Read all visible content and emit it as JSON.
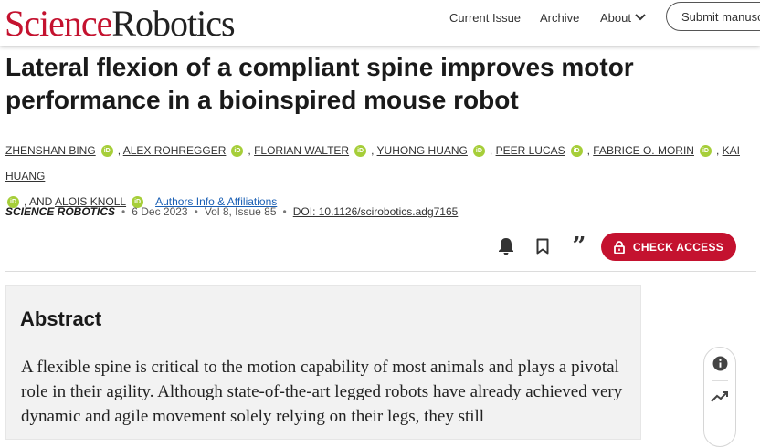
{
  "header": {
    "logo": {
      "science": "Science",
      "robotics": "Robotics"
    },
    "nav": {
      "current_issue": "Current Issue",
      "archive": "Archive",
      "about": "About"
    },
    "submit_label": "Submit manuscript"
  },
  "article": {
    "title": "Lateral flexion of a compliant spine improves motor performance in a bioinspired mouse robot",
    "authors": [
      "Zhenshan Bing",
      "Alex Rohregger",
      "Florian Walter",
      "Yuhong Huang",
      "Peer Lucas",
      "Fabrice O. Morin",
      "Kai Huang",
      "Alois Knoll"
    ],
    "orcid_label": "iD",
    "and_label": ", AND",
    "affiliations_link": "Authors Info & Affiliations",
    "journal": "SCIENCE ROBOTICS",
    "date": "6 Dec 2023",
    "volume": "Vol 8, Issue 85",
    "doi": "DOI: 10.1126/scirobotics.adg7165",
    "meta_separator": "•"
  },
  "toolbar": {
    "access_label": "CHECK ACCESS",
    "quote_glyph": "”"
  },
  "abstract": {
    "heading": "Abstract",
    "text": "A flexible spine is critical to the motion capability of most animals and plays a pivotal role in their agility. Although state-of-the-art legged robots have already achieved very dynamic and agile movement solely relying on their legs, they still"
  },
  "colors": {
    "brand": "#c4122f",
    "orcid": "#a6ce39",
    "link": "#1a5fb4",
    "abstract_bg": "#f2f2f2"
  },
  "icons": [
    "chevron-down-icon",
    "bell-icon",
    "bookmark-icon",
    "quote-icon",
    "lock-icon",
    "info-icon",
    "trending-icon",
    "orcid-icon"
  ]
}
